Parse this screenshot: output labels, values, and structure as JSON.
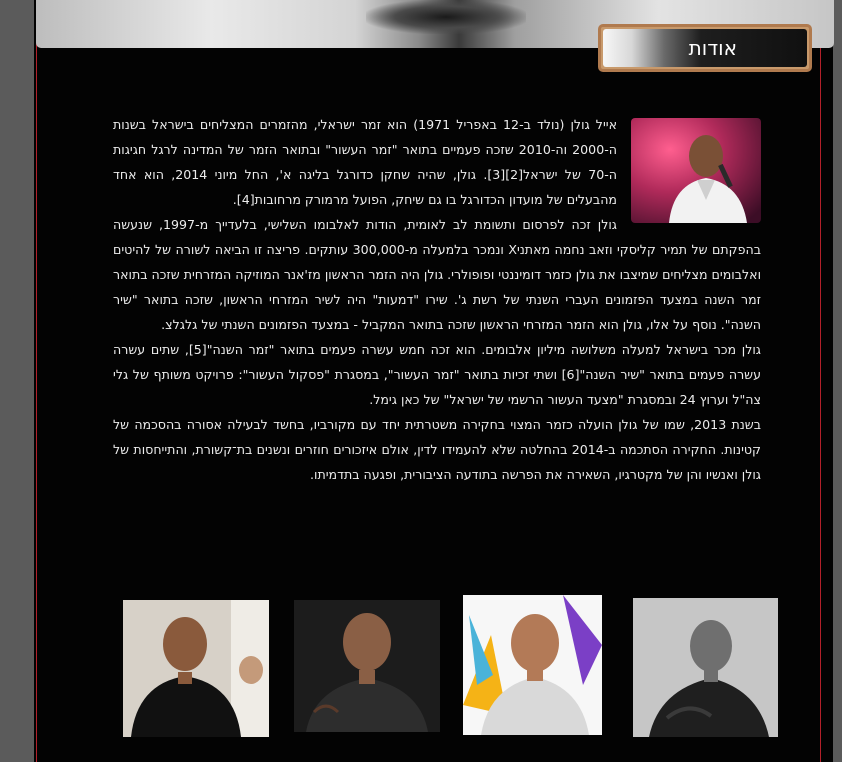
{
  "page": {
    "section_title": "אודות",
    "paragraphs": [
      "אייל גולן (נולד ב-12 באפריל 1971) הוא זמר ישראלי, מהזמרים המצליחים בישראל בשנות ה-2000 וה-2010 שזכה פעמיים בתואר \"זמר העשור\" ובתואר הזמר של המדינה לרגל חגיגות ה-70 של ישראל[2][3]. גולן, שהיה שחקן כדורגל בליגה א', החל מיוני 2014, הוא אחד מהבעלים של מועדון הכדורגל בו גם שיחק, הפועל מרמורק מרחובות[4].",
      "גולן זכה לפרסום ותשומת לב לאומית, הודות לאלבומו השלישי, בלעדייך מ-1997, שנעשה בהפקתם של תמיר קליסקי וזאב נחמה מאתניX ונמכר בלמעלה מ-300,000 עותקים. פריצה זו הביאה לשורה של להיטים ואלבומים מצליחים שמיצבו את גולן כזמר דומיננטי ופופולרי. גולן היה הזמר הראשון מז'אנר המוזיקה המזרחית שזכה בתואר זמר השנה במצעד הפזמונים העברי השנתי של רשת ג'. שירו \"דמעות\" היה לשיר המזרחי הראשון, שזכה בתואר \"שיר השנה\". נוסף על אלו, גולן הוא הזמר המזרחי הראשון שזכה בתואר המקביל - במצעד הפזמונים השנתי של גלגלצ.",
      "גולן מכר בישראל למעלה משלושה מיליון אלבומים. הוא זכה חמש עשרה פעמים בתואר \"זמר השנה\"[5], שתים עשרה עשרה פעמים בתואר \"שיר השנה\"[6] ושתי זכיות בתואר \"זמר העשור\", במסגרת \"פסקול העשור\": פרויקט משותף של גלי צה\"ל וערוץ 24 ובמסגרת \"מצעד העשור הרשמי של ישראל\" של כאן גימל.",
      "בשנת 2013, שמו של גולן הועלה כזמר המצוי בחקירה משטרתית יחד עם מקורביו, בחשד לבעילה אסורה בהסכמה של קטינות. החקירה הסתכמה ב-2014 בהחלטה שלא להעמידו לדין, אולם איזכורים חוזרים ונשנים בת־קשורת, והתייחסות של גולן ואנשיו והן של מקטרגיו, השאירה את הפרשה בתודעה הציבורית, ופגעה בתדמיתו."
    ],
    "colors": {
      "page_background": "#030303",
      "text": "#ececec",
      "border_red": "#b3202a",
      "badge_frame": "#c89a6c"
    }
  }
}
